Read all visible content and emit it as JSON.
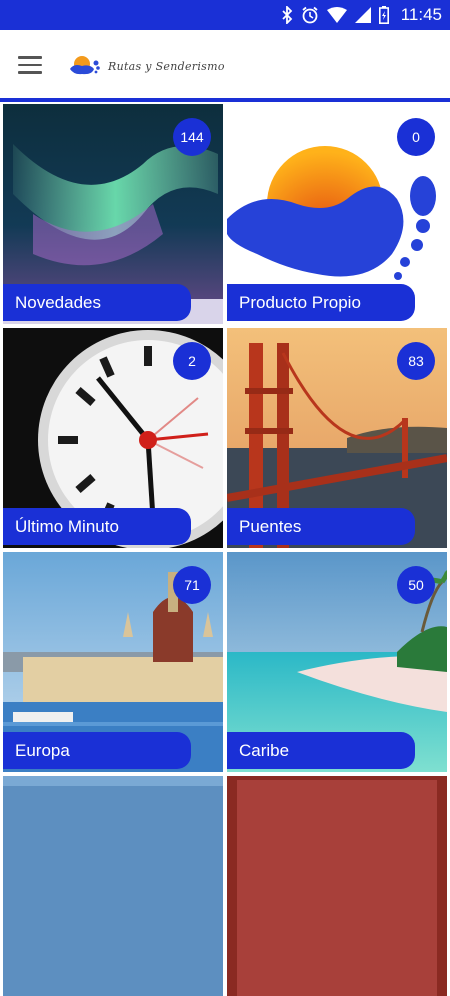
{
  "status_bar": {
    "time": "11:45",
    "icons": [
      "bluetooth-icon",
      "alarm-icon",
      "wifi-icon",
      "signal-icon",
      "battery-icon"
    ]
  },
  "app_bar": {
    "menu_icon": "hamburger-menu-icon",
    "logo_text": "Rutas y Senderismo"
  },
  "colors": {
    "primary": "#1a30d6",
    "background": "#ffffff"
  },
  "categories": [
    {
      "label": "Novedades",
      "count": "144"
    },
    {
      "label": "Producto Propio",
      "count": "0"
    },
    {
      "label": "Último Minuto",
      "count": "2"
    },
    {
      "label": "Puentes",
      "count": "83"
    },
    {
      "label": "Europa",
      "count": "71"
    },
    {
      "label": "Caribe",
      "count": "50"
    }
  ]
}
